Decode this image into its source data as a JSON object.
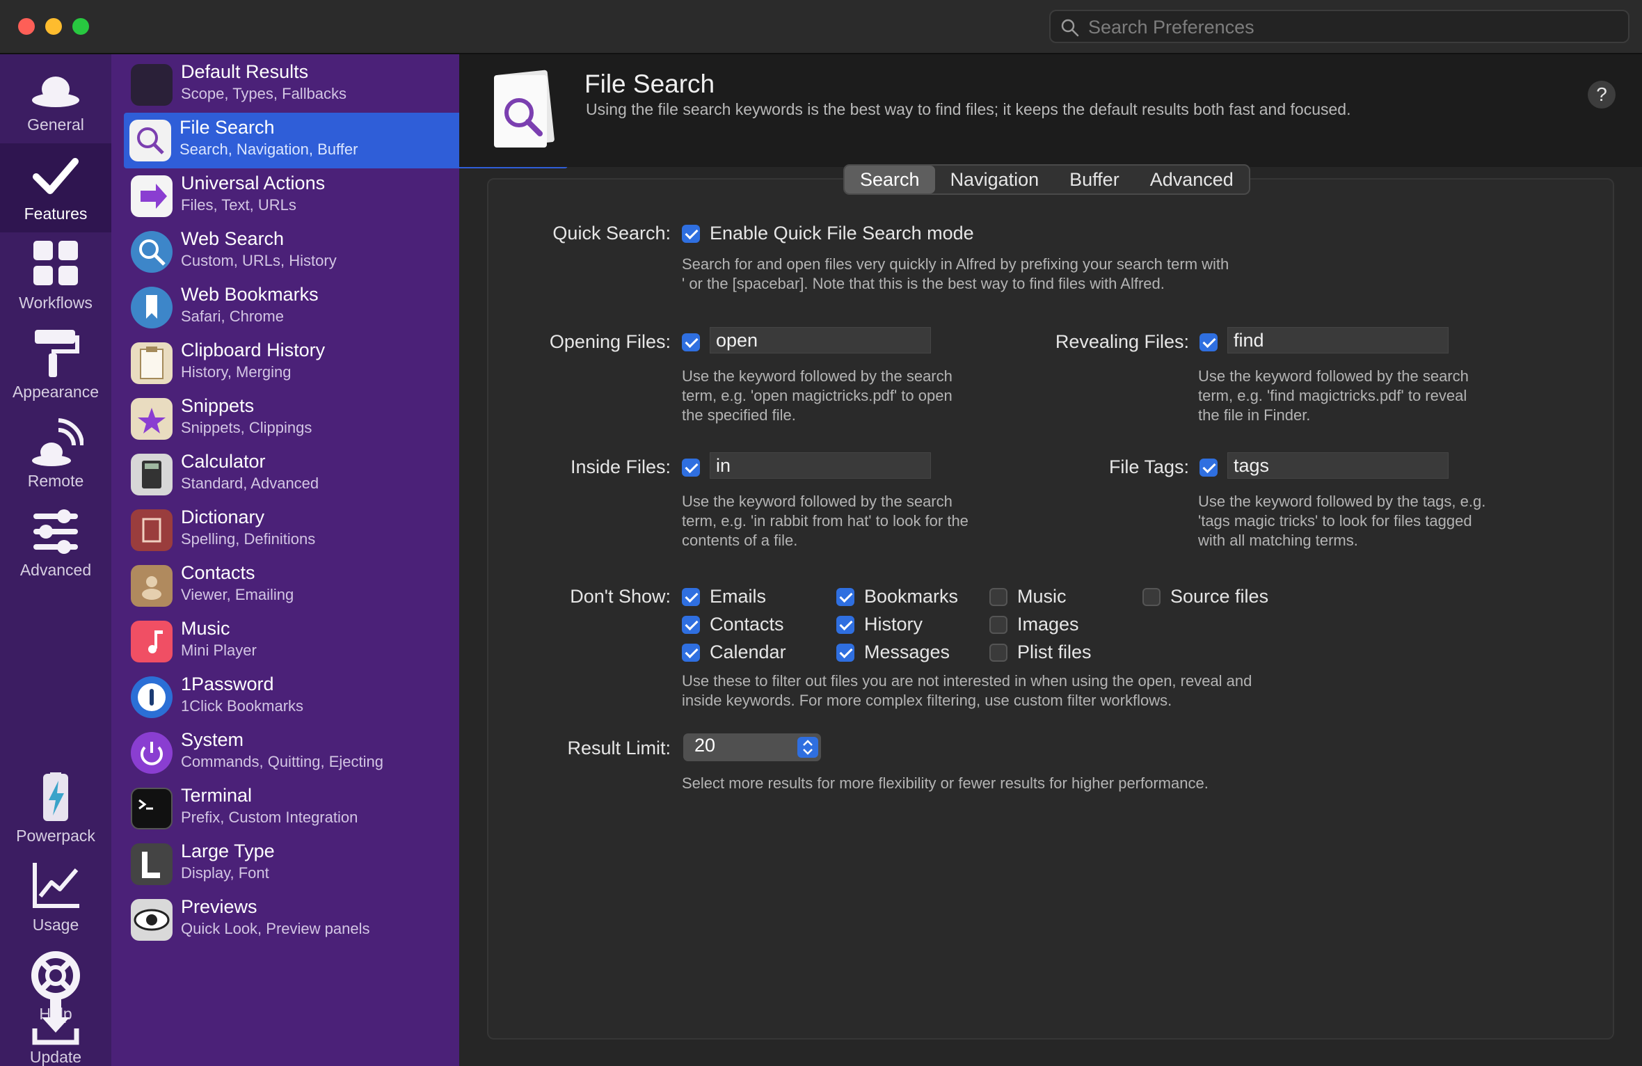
{
  "window": {
    "search_placeholder": "Search Preferences"
  },
  "rail": [
    {
      "label": "General",
      "icon": "cloud-hat-icon"
    },
    {
      "label": "Features",
      "icon": "checkmark-icon"
    },
    {
      "label": "Workflows",
      "icon": "grid-icon"
    },
    {
      "label": "Appearance",
      "icon": "paint-roller-icon"
    },
    {
      "label": "Remote",
      "icon": "remote-signal-icon"
    },
    {
      "label": "Advanced",
      "icon": "sliders-icon"
    },
    {
      "label": "Powerpack",
      "icon": "battery-bolt-icon"
    },
    {
      "label": "Usage",
      "icon": "line-chart-icon"
    },
    {
      "label": "Help",
      "icon": "lifebuoy-icon"
    },
    {
      "label": "Update",
      "icon": "download-icon"
    }
  ],
  "features": [
    {
      "title": "Default Results",
      "sub": "Scope, Types, Fallbacks"
    },
    {
      "title": "File Search",
      "sub": "Search, Navigation, Buffer"
    },
    {
      "title": "Universal Actions",
      "sub": "Files, Text, URLs"
    },
    {
      "title": "Web Search",
      "sub": "Custom, URLs, History"
    },
    {
      "title": "Web Bookmarks",
      "sub": "Safari, Chrome"
    },
    {
      "title": "Clipboard History",
      "sub": "History, Merging"
    },
    {
      "title": "Snippets",
      "sub": "Snippets, Clippings"
    },
    {
      "title": "Calculator",
      "sub": "Standard, Advanced"
    },
    {
      "title": "Dictionary",
      "sub": "Spelling, Definitions"
    },
    {
      "title": "Contacts",
      "sub": "Viewer, Emailing"
    },
    {
      "title": "Music",
      "sub": "Mini Player"
    },
    {
      "title": "1Password",
      "sub": "1Click Bookmarks"
    },
    {
      "title": "System",
      "sub": "Commands, Quitting, Ejecting"
    },
    {
      "title": "Terminal",
      "sub": "Prefix, Custom Integration"
    },
    {
      "title": "Large Type",
      "sub": "Display, Font"
    },
    {
      "title": "Previews",
      "sub": "Quick Look, Preview panels"
    }
  ],
  "header": {
    "title": "File Search",
    "subtitle": "Using the file search keywords is the best way to find files; it keeps the default results both fast and focused.",
    "help": "?"
  },
  "tabs": [
    "Search",
    "Navigation",
    "Buffer",
    "Advanced"
  ],
  "quick_search": {
    "label": "Quick Search:",
    "checkbox": "Enable Quick File Search mode",
    "desc1": "Search for and open files very quickly in Alfred by prefixing your search term with",
    "desc2": "' or the [spacebar]. Note that this is the best way to find files with Alfred."
  },
  "opening": {
    "label": "Opening Files:",
    "value": "open",
    "desc1": "Use the keyword followed by the search",
    "desc2": "term, e.g. 'open magictricks.pdf' to open",
    "desc3": "the specified file."
  },
  "revealing": {
    "label": "Revealing Files:",
    "value": "find",
    "desc1": "Use the keyword followed by the search",
    "desc2": "term, e.g. 'find magictricks.pdf' to reveal",
    "desc3": "the file in Finder."
  },
  "inside": {
    "label": "Inside Files:",
    "value": "in",
    "desc1": "Use the keyword followed by the search",
    "desc2": "term, e.g. 'in rabbit from hat' to look for the",
    "desc3": "contents of a file."
  },
  "tags": {
    "label": "File Tags:",
    "value": "tags",
    "desc1": "Use the keyword followed by the tags, e.g.",
    "desc2": "'tags magic tricks' to look for files tagged",
    "desc3": "with all matching terms."
  },
  "dont_show": {
    "label": "Don't Show:",
    "items": [
      "Emails",
      "Contacts",
      "Calendar",
      "Bookmarks",
      "History",
      "Messages",
      "Music",
      "Images",
      "Plist files",
      "Source files"
    ],
    "checked": [
      true,
      true,
      true,
      true,
      true,
      true,
      false,
      false,
      false,
      false
    ],
    "desc1": "Use these to filter out files you are not interested in when using the open, reveal and",
    "desc2": "inside keywords. For more complex filtering, use custom filter workflows."
  },
  "result_limit": {
    "label": "Result Limit:",
    "value": "20",
    "desc": "Select more results for more flexibility or fewer results for higher performance."
  }
}
